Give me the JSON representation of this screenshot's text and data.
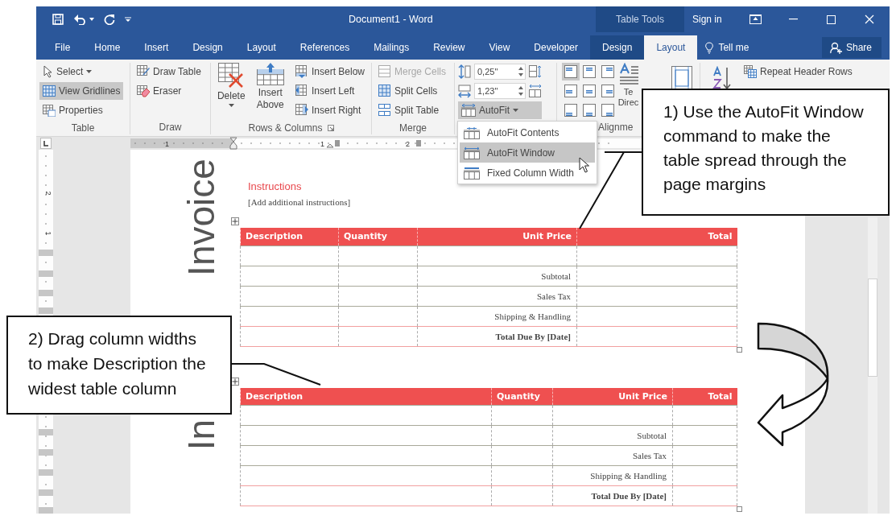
{
  "window": {
    "title": "Document1 - Word",
    "context_label": "Table Tools",
    "sign_in": "Sign in"
  },
  "tabs": [
    {
      "label": "File",
      "kind": "tab",
      "selected": false
    },
    {
      "label": "Home",
      "kind": "tab",
      "selected": false
    },
    {
      "label": "Insert",
      "kind": "tab",
      "selected": false
    },
    {
      "label": "Design",
      "kind": "tab",
      "selected": false
    },
    {
      "label": "Layout",
      "kind": "tab",
      "selected": false
    },
    {
      "label": "References",
      "kind": "tab",
      "selected": false
    },
    {
      "label": "Mailings",
      "kind": "tab",
      "selected": false
    },
    {
      "label": "Review",
      "kind": "tab",
      "selected": false
    },
    {
      "label": "View",
      "kind": "tab",
      "selected": false
    },
    {
      "label": "Developer",
      "kind": "tab",
      "selected": false
    },
    {
      "label": "Design",
      "kind": "contextual",
      "selected": false
    },
    {
      "label": "Layout",
      "kind": "contextual",
      "selected": true
    }
  ],
  "tell_me": {
    "label": "Tell me"
  },
  "share": {
    "label": "Share"
  },
  "ribbon": {
    "table_group": {
      "label": "Table",
      "items": [
        {
          "label": "Select",
          "dropdown": true,
          "selected": false
        },
        {
          "label": "View Gridlines",
          "dropdown": false,
          "selected": true
        },
        {
          "label": "Properties",
          "dropdown": false,
          "selected": false
        }
      ]
    },
    "draw_group": {
      "label": "Draw",
      "items": [
        {
          "label": "Draw Table"
        },
        {
          "label": "Eraser"
        }
      ]
    },
    "rows_columns_group": {
      "label": "Rows & Columns",
      "large_buttons": [
        {
          "label": "Delete",
          "dropdown": true
        },
        {
          "label": "Insert Above",
          "dropdown": false
        }
      ],
      "small_buttons": [
        {
          "label": "Insert Below"
        },
        {
          "label": "Insert Left"
        },
        {
          "label": "Insert Right"
        }
      ]
    },
    "merge_group": {
      "label": "Merge",
      "items": [
        {
          "label": "Merge Cells",
          "disabled": true
        },
        {
          "label": "Split Cells",
          "disabled": false
        },
        {
          "label": "Split Table",
          "disabled": false
        }
      ]
    },
    "cell_size_group": {
      "height": "0,25\"",
      "width": "1,23\"",
      "autofit": {
        "label": "AutoFit",
        "dropdown": true,
        "selected": true
      }
    },
    "alignment_group": {
      "label": "Alignme",
      "alignments": [
        {
          "selected": true
        },
        {
          "selected": false
        },
        {
          "selected": false
        },
        {
          "selected": false
        },
        {
          "selected": false
        },
        {
          "selected": false
        },
        {
          "selected": false
        },
        {
          "selected": false
        },
        {
          "selected": false
        }
      ],
      "text_direction": [
        "Te",
        "Direc"
      ]
    },
    "data_group": {
      "repeat_header_rows": "Repeat Header Rows"
    }
  },
  "autofit_menu": {
    "items": [
      {
        "label": "AutoFit Contents",
        "selected": false
      },
      {
        "label": "AutoFit Window",
        "selected": true
      },
      {
        "label": "Fixed Column Width",
        "selected": false
      }
    ]
  },
  "ruler": {
    "horizontal_numbers": [
      "1",
      "1",
      "2"
    ],
    "vertical_numbers": [
      "2",
      "1"
    ]
  },
  "document": {
    "sections": [
      {
        "heading": "Invoice",
        "instructions_title": "Instructions",
        "instructions_text": "[Add additional instructions]",
        "table": {
          "columns": [
            {
              "label": "Description"
            },
            {
              "label": "Quantity"
            },
            {
              "label": "Unit Price"
            },
            {
              "label": "Total"
            }
          ],
          "rows": [
            {
              "kind": "item"
            },
            {
              "kind": "summary",
              "label": "Subtotal"
            },
            {
              "kind": "summary",
              "label": "Sales Tax"
            },
            {
              "kind": "summary",
              "label": "Shipping & Handling"
            },
            {
              "kind": "total",
              "label": "Total Due By [Date]"
            }
          ]
        }
      },
      {
        "heading": "In",
        "table": {
          "columns": [
            {
              "label": "Description"
            },
            {
              "label": "Quantity"
            },
            {
              "label": "Unit Price"
            },
            {
              "label": "Total"
            }
          ],
          "rows": [
            {
              "kind": "item"
            },
            {
              "kind": "summary",
              "label": "Subtotal"
            },
            {
              "kind": "summary",
              "label": "Sales Tax"
            },
            {
              "kind": "summary",
              "label": "Shipping & Handling"
            },
            {
              "kind": "total",
              "label": "Total Due By [Date]"
            }
          ]
        }
      }
    ]
  },
  "callouts": [
    {
      "text": "1) Use the AutoFit Window command to make the table spread through the page margins"
    },
    {
      "text": "2) Drag column widths to make Description the widest table column"
    }
  ]
}
